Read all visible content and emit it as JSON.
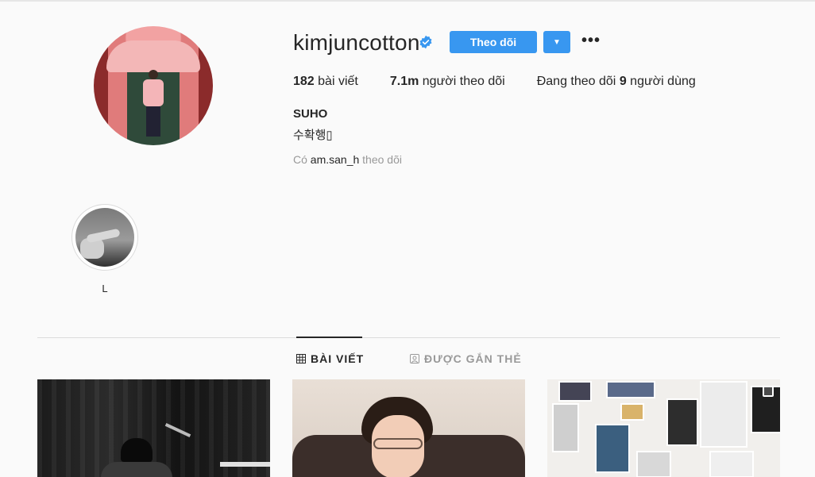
{
  "profile": {
    "username": "kimjuncotton",
    "verified_icon": "verified-badge-icon",
    "follow_label": "Theo dõi",
    "dropdown_icon": "chevron-down-icon",
    "more_label": "•••",
    "stats": {
      "posts_count": "182",
      "posts_label": "bài viết",
      "followers_count": "7.1m",
      "followers_label": "người theo dõi",
      "following_prefix": "Đang theo dõi",
      "following_count": "9",
      "following_suffix": "người dùng"
    },
    "full_name": "SUHO",
    "bio": "수확행▯",
    "followed_by": {
      "prefix": "Có",
      "user": "am.san_h",
      "suffix": "theo dõi"
    }
  },
  "highlights": [
    {
      "label": "L"
    }
  ],
  "tabs": [
    {
      "label": "BÀI VIẾT",
      "icon": "grid-icon",
      "active": true
    },
    {
      "label": "ĐƯỢC GẮN THẺ",
      "icon": "tagged-icon",
      "active": false
    }
  ],
  "colors": {
    "accent": "#3897f0",
    "background": "#fafafa",
    "text": "#262626",
    "muted": "#999999"
  }
}
